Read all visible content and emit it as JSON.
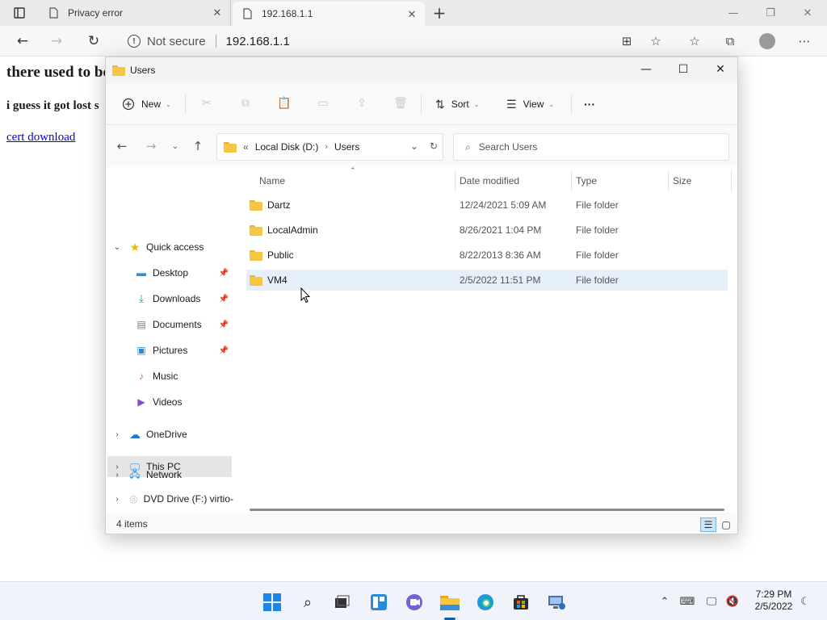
{
  "browser": {
    "tabs": [
      {
        "title": "Privacy error",
        "icon": "page-icon"
      },
      {
        "title": "192.168.1.1",
        "icon": "page-icon"
      }
    ],
    "address": {
      "security_label": "Not secure",
      "url": "192.168.1.1"
    }
  },
  "page": {
    "heading": "there used to be",
    "subheading": "i guess it got lost s",
    "link": "cert download"
  },
  "explorer": {
    "title": "Users",
    "commands": {
      "new_label": "New",
      "sort_label": "Sort",
      "view_label": "View",
      "more_label": "···"
    },
    "breadcrumb": {
      "overflow": "«",
      "parts": [
        "Local Disk (D:)",
        "Users"
      ]
    },
    "search": {
      "placeholder": "Search Users"
    },
    "sidebar": {
      "quick_access": "Quick access",
      "quick_items": [
        {
          "label": "Desktop",
          "icon": "desktop-icon",
          "pinned": true
        },
        {
          "label": "Downloads",
          "icon": "download-icon",
          "pinned": true
        },
        {
          "label": "Documents",
          "icon": "documents-icon",
          "pinned": true
        },
        {
          "label": "Pictures",
          "icon": "pictures-icon",
          "pinned": true
        },
        {
          "label": "Music",
          "icon": "music-icon",
          "pinned": false
        },
        {
          "label": "Videos",
          "icon": "videos-icon",
          "pinned": false
        }
      ],
      "onedrive": "OneDrive",
      "this_pc": "This PC",
      "dvd": "DVD Drive (F:) virtio-",
      "network": "Network"
    },
    "columns": {
      "name": "Name",
      "date": "Date modified",
      "type": "Type",
      "size": "Size"
    },
    "rows": [
      {
        "name": "Dartz",
        "date": "12/24/2021 5:09 AM",
        "type": "File folder"
      },
      {
        "name": "LocalAdmin",
        "date": "8/26/2021 1:04 PM",
        "type": "File folder"
      },
      {
        "name": "Public",
        "date": "8/22/2013 8:36 AM",
        "type": "File folder"
      },
      {
        "name": "VM4",
        "date": "2/5/2022 11:51 PM",
        "type": "File folder"
      }
    ],
    "status": "4 items"
  },
  "taskbar": {
    "time": "7:29 PM",
    "date": "2/5/2022"
  },
  "colors": {
    "accent": "#0067c0",
    "folder": "#f6c544",
    "hover_row": "#e5f0fb",
    "link": "#0000ee"
  }
}
